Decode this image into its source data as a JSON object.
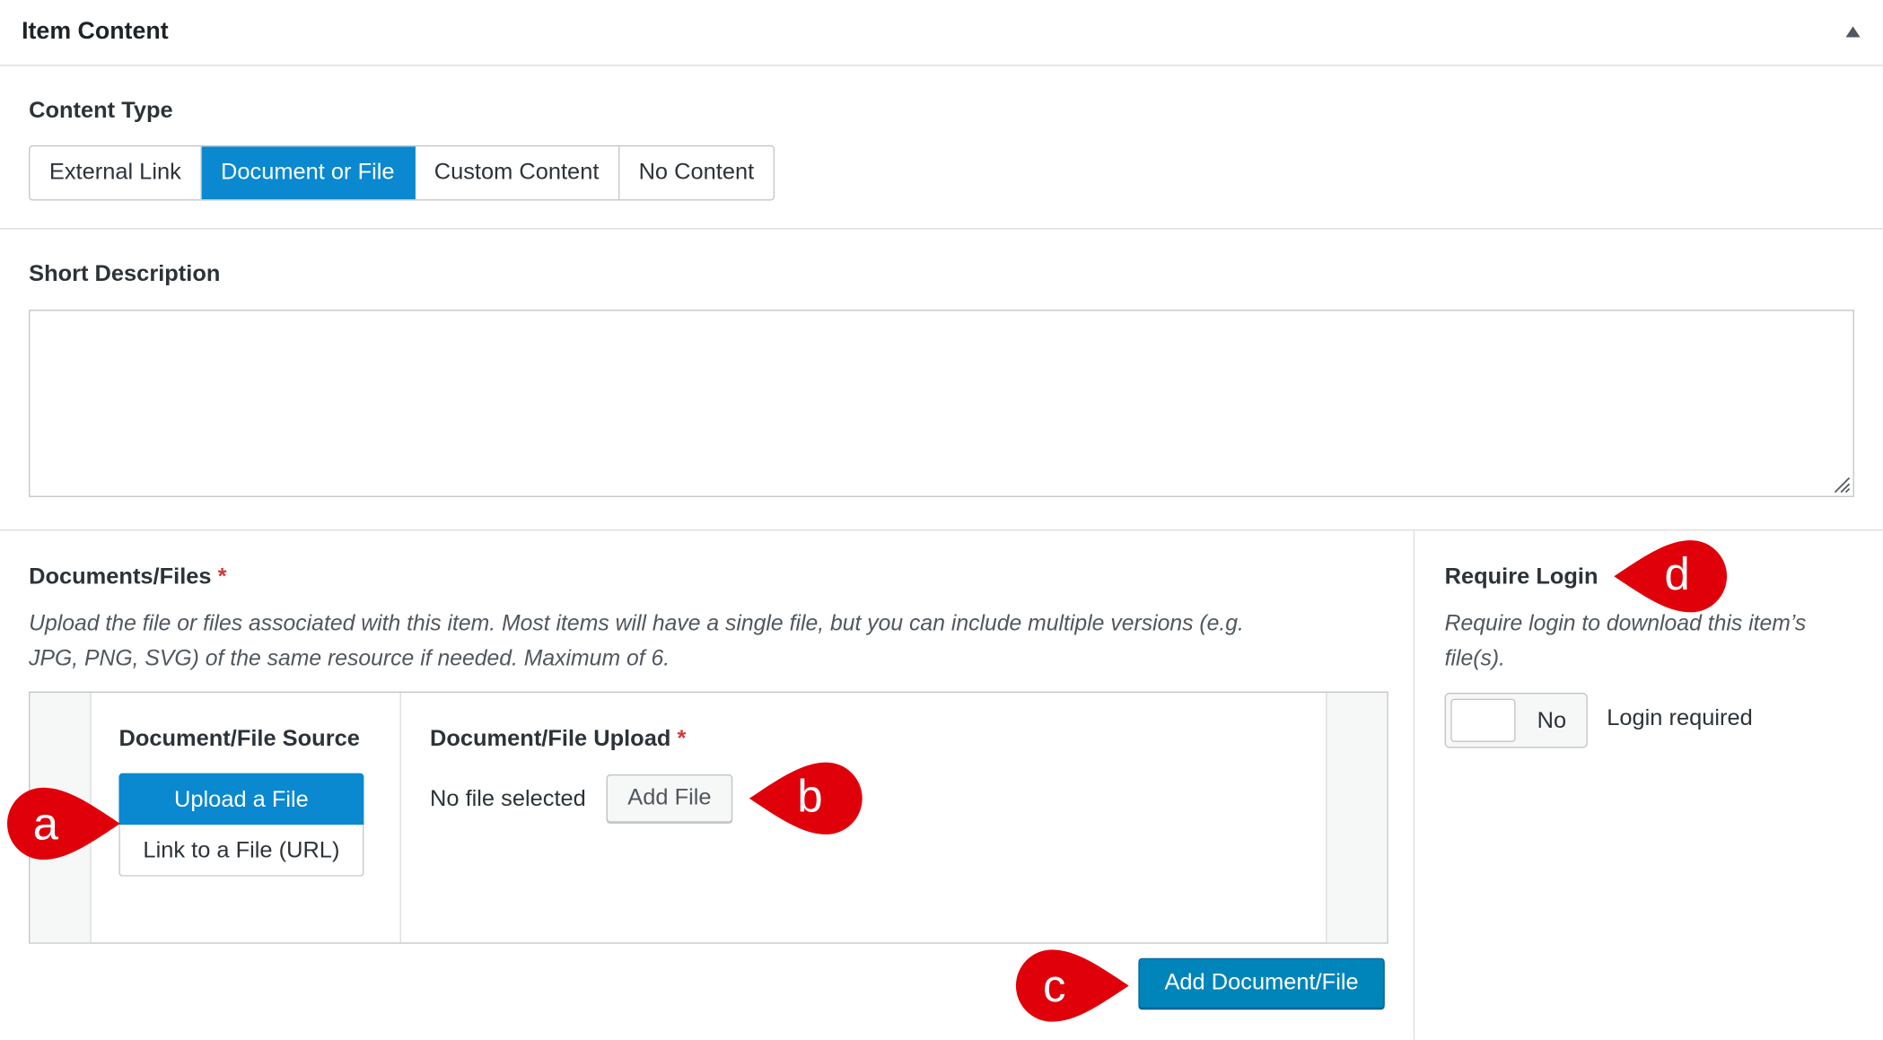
{
  "panel": {
    "title": "Item Content",
    "collapse_icon": "triangle-up-icon"
  },
  "content_type": {
    "label": "Content Type",
    "options": [
      "External Link",
      "Document or File",
      "Custom Content",
      "No Content"
    ],
    "selected": "Document or File"
  },
  "short_description": {
    "label": "Short Description",
    "value": ""
  },
  "documents": {
    "label": "Documents/Files",
    "required_mark": "*",
    "help_line1": "Upload the file or files associated with this item. Most items will have a single file, but you can include multiple versions (e.g.",
    "help_line2": "JPG, PNG, SVG) of the same resource if needed. Maximum of 6.",
    "source_label": "Document/File Source",
    "source_options": [
      "Upload a File",
      "Link to a File (URL)"
    ],
    "source_selected": "Upload a File",
    "upload_label": "Document/File Upload",
    "upload_required_mark": "*",
    "file_status": "No file selected",
    "add_file_button": "Add File",
    "add_document_button": "Add Document/File"
  },
  "require_login": {
    "label": "Require Login",
    "help_line1": "Require login to download this item’s",
    "help_line2": "file(s).",
    "toggle_value": "No",
    "toggle_caption": "Login required"
  },
  "annotations": {
    "color": "#e0000a",
    "a": "a",
    "b": "b",
    "c": "c",
    "d": "d"
  },
  "colors": {
    "primary": "#0085ba",
    "selected_tab": "#0a88d0",
    "required": "#d63638"
  }
}
